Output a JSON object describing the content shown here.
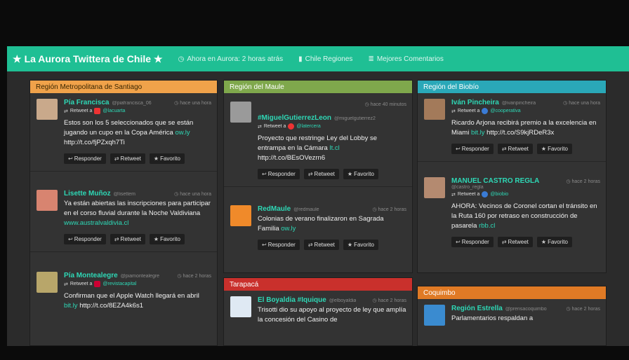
{
  "app": {
    "title": "La Aurora Twittera de Chile",
    "nav": [
      {
        "icon": "clock-icon",
        "label": "Ahora en Aurora: 2 horas atrás"
      },
      {
        "icon": "document-icon",
        "label": "Chile Regiones"
      },
      {
        "icon": "list-icon",
        "label": "Mejores Comentarios"
      }
    ]
  },
  "ui": {
    "reply_label": "Responder",
    "retweet_label": "Retweet",
    "fav_label": "Favorito",
    "retweet_prefix": "Retweet a"
  },
  "columns": [
    {
      "title": "Región Metropolitana de Santiago",
      "color": "#f0a24a",
      "tweets": [
        {
          "name": "Pía Francisca",
          "handle": "@piafrancisca_06",
          "time": "hace una hora",
          "rt_user": "@lacuarta",
          "text": "Estos son los 5 seleccionados que se están jugando un cupo en la Copa América",
          "link": "ow.ly",
          "text2": "http://t.co/fjPZxqh7Ti",
          "avatar_color": "#c9a98b",
          "mini_color": "#e33"
        },
        {
          "name": "Lisette Muñoz",
          "handle": "@lisettem",
          "time": "hace una hora",
          "rt_user": "",
          "text": "Ya están abiertas las inscripciones para participar en el corso fluvial durante la Noche Valdiviana",
          "link": "www.australvaldivia.cl",
          "text2": "",
          "avatar_color": "#d88470",
          "mini_color": ""
        },
        {
          "name": "Pía Montealegre",
          "handle": "@piamontealegre",
          "time": "hace 2 horas",
          "rt_user": "@revistacapital",
          "text": "Confirman que el Apple Watch llegará en abril",
          "link": "bit.ly",
          "text2": "http://t.co/8EZA4k6s1",
          "avatar_color": "#b8a66a",
          "mini_color": "#c03"
        }
      ]
    },
    {
      "title": "Región del Maule",
      "color": "#7fa84c",
      "tweets": [
        {
          "name": "#MiguelGutierrezLeon",
          "handle": "@miguelgutierrez2",
          "time": "hace 40 minutos",
          "rt_user": "@latercera",
          "text": "Proyecto que restringe Ley del Lobby se entrampa en la Cámara",
          "link": "lt.cl",
          "text2": "http://t.co/BEsOVezrn6",
          "avatar_color": "#9a9a9a",
          "mini_color": "#e33"
        },
        {
          "name": "RedMaule",
          "handle": "@redmaule",
          "time": "hace 2 horas",
          "rt_user": "",
          "text": "Colonias de verano finalizaron en Sagrada Familia",
          "link": "ow.ly",
          "text2": "",
          "avatar_color": "#f08a2a",
          "mini_color": ""
        }
      ]
    },
    {
      "title": "Tarapacá",
      "color": "#c9302c",
      "tweets": [
        {
          "name": "El Boyaldia #Iquique",
          "handle": "@elboyaldia",
          "time": "hace 2 horas",
          "rt_user": "",
          "text": "Trisotti dio su apoyo al proyecto de ley que amplía la concesión del Casino de",
          "link": "",
          "text2": "",
          "avatar_color": "#dfe9f3",
          "mini_color": ""
        }
      ]
    },
    {
      "title": "Región del Biobío",
      "color": "#2aa8b8",
      "tweets": [
        {
          "name": "Iván Pincheira",
          "handle": "@ivanpincheira",
          "time": "hace una hora",
          "rt_user": "@cooperativa",
          "text": "Ricardo Arjona recibirá premio a la excelencia en Miami",
          "link": "bit.ly",
          "text2": "http://t.co/S9kjRDeR3x",
          "avatar_color": "#a37a5a",
          "mini_color": "#3a7bd5"
        },
        {
          "name": "MANUEL CASTRO REGLA",
          "handle": "@castro_regla",
          "time": "hace 2 horas",
          "rt_user": "@biobio",
          "text": "AHORA: Vecinos de Coronel cortan el tránsito en la Ruta 160 por retraso en construcción de pasarela",
          "link": "rbb.cl",
          "text2": "",
          "avatar_color": "#b48a70",
          "mini_color": "#3a7bd5"
        }
      ]
    },
    {
      "title": "Coquimbo",
      "color": "#e07a25",
      "tweets": [
        {
          "name": "Región Estrella",
          "handle": "@prensacoquimbo",
          "time": "hace 2 horas",
          "rt_user": "",
          "text": "Parlamentarios respaldan a",
          "link": "",
          "text2": "",
          "avatar_color": "#3a8bd0",
          "mini_color": ""
        }
      ]
    }
  ]
}
